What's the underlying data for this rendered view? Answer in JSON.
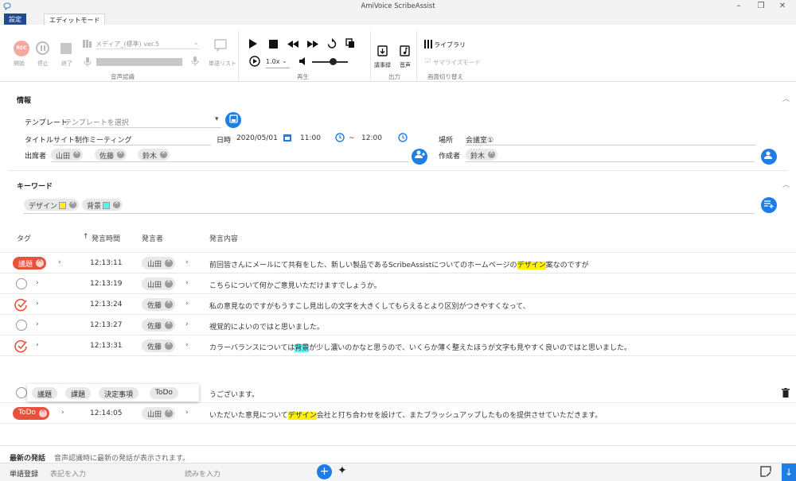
{
  "window": {
    "title": "AmiVoice ScribeAssist"
  },
  "tabs": {
    "settings": "設定",
    "edit_mode": "エディットモード"
  },
  "ribbon": {
    "rec_badge": "REC",
    "rec_start": "開始",
    "pause": "停止",
    "stop": "終了",
    "media_select": "メディア_(標準) ver.5",
    "word_list": "単語リスト",
    "group_speech": "音声認識",
    "speed": "1.0x",
    "group_play": "再生",
    "out_minutes": "議事録",
    "out_audio": "音声",
    "group_output": "出力",
    "library": "ライブラリ",
    "summary_mode": "サマライズモード",
    "group_screen": "画面切り替え"
  },
  "info": {
    "title": "情報",
    "template_label": "テンプレート",
    "template_placeholder": "テンプレートを選択",
    "title_label": "タイトル",
    "title_value": "サイト制作ミーティング",
    "datetime_label": "日時",
    "date": "2020/05/01",
    "start_time": "11:00",
    "tilde": "~",
    "end_time": "12:00",
    "place_label": "場所",
    "place_value": "会議室①",
    "attendees_label": "出席者",
    "attendees": [
      "山田",
      "佐藤",
      "鈴木"
    ],
    "author_label": "作成者",
    "author": "鈴木"
  },
  "keywords": {
    "title": "キーワード",
    "items": [
      {
        "label": "デザイン",
        "color": "#fff200"
      },
      {
        "label": "背景",
        "color": "#5ff0f0"
      }
    ]
  },
  "table": {
    "headers": {
      "tag": "タグ",
      "sort_arrow": "↑",
      "time": "発言時間",
      "speaker": "発言者",
      "content": "発言内容"
    },
    "rows": [
      {
        "tag": "議題",
        "status": "tag",
        "time": "12:13:11",
        "speaker": "山田",
        "pre": "前回皆さんにメールにて共有をした、新しい製品であるScribeAssistについてのホームページの",
        "hl": "デザイン",
        "hlcolor": "y",
        "post": "案なのですが"
      },
      {
        "tag": "",
        "status": "empty",
        "time": "12:13:19",
        "speaker": "山田",
        "pre": "こちらについて何かご意見いただけますでしょうか。",
        "hl": "",
        "hlcolor": "",
        "post": ""
      },
      {
        "tag": "",
        "status": "check",
        "time": "12:13:24",
        "speaker": "佐藤",
        "pre": "私の意見なのですがもうすこし見出しの文字を大きくしてもらえるとより区別がつきやすくなって、",
        "hl": "",
        "hlcolor": "",
        "post": ""
      },
      {
        "tag": "",
        "status": "empty",
        "time": "12:13:27",
        "speaker": "佐藤",
        "pre": "視覚的によいのではと思いました。",
        "hl": "",
        "hlcolor": "",
        "post": ""
      },
      {
        "tag": "",
        "status": "check",
        "time": "12:13:31",
        "speaker": "佐藤",
        "pre": "カラーバランスについては",
        "hl": "背景",
        "hlcolor": "c",
        "post": "が少し濃いのかなと思うので、いくらか薄く整えたほうが文字も見やすく良いのではと思いました。"
      },
      {
        "tag": "",
        "status": "popup",
        "time": "",
        "speaker": "",
        "pre": "うございます。",
        "hl": "",
        "hlcolor": "",
        "post": ""
      },
      {
        "tag": "ToDo",
        "status": "tag",
        "time": "12:14:05",
        "speaker": "山田",
        "pre": "いただいた意見について",
        "hl": "デザイン",
        "hlcolor": "y",
        "post": "会社と打ち合わせを設けて、またブラッシュアップしたものを提供させていただきます。"
      }
    ]
  },
  "tag_popup": {
    "options": [
      "議題",
      "課題",
      "決定事項",
      "ToDo"
    ]
  },
  "latest": {
    "label": "最新の発話",
    "text": "音声認識時に最新の発話が表示されます。"
  },
  "bottom": {
    "word_reg_label": "単語登録",
    "notation_placeholder": "表記を入力",
    "reading_placeholder": "読みを入力"
  },
  "colors": {
    "accent": "#1e7ee6",
    "tag_red": "#e8523d",
    "check_red": "#e8523d",
    "nav_blue": "#1f4a8c"
  }
}
